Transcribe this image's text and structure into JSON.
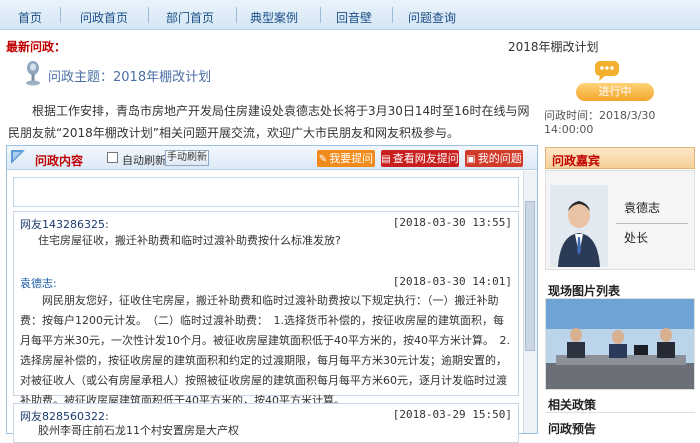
{
  "nav": {
    "items": [
      "首页",
      "问政首页",
      "部门首页",
      "典型案例",
      "回音壁",
      "问题查询"
    ]
  },
  "latest": {
    "label": "最新问政：",
    "right_title": "2018年棚改计划",
    "theme_label": "问政主题：2018年棚改计划",
    "status": "进行中",
    "time_label": "问政时间：",
    "time_value": "2018/3/30 14:00:00",
    "intro": "根据工作安排，青岛市房地产开发局住房建设处袁德志处长将于3月30日14时至16时在线与网民朋友就“2018年棚改计划”相关问题开展交流，欢迎广大市民朋友和网友积极参与。"
  },
  "panel": {
    "title": "问政内容",
    "auto_refresh": "自动刷新",
    "manual_refresh": "手动刷新",
    "btn_ask": "我要提问",
    "btn_view": "查看网友提问",
    "btn_mine": "我的问题"
  },
  "messages": [
    {
      "user": "网友143286325:",
      "time": "[2018-03-30 13:55]",
      "text": "住宅房屋征收，搬迁补助费和临时过渡补助费按什么标准发放?"
    },
    {
      "user": "网友828560322:",
      "time": "[2018-03-29 15:50]",
      "text": "胶州李哥庄前石龙11个村安置房是大产权"
    }
  ],
  "answer": {
    "name": "袁德志:",
    "time": "[2018-03-30 14:01]",
    "text": "网民朋友您好，征收住宅房屋，搬迁补助费和临时过渡补助费按以下规定执行：（一）搬迁补助费：按每户1200元计发。　（二）临时过渡补助费：　1.选择货币补偿的，按征收房屋的建筑面积，每月每平方米30元，一次性计发10个月。被征收房屋建筑面积低于40平方米的，按40平方米计算。　2.选择房屋补偿的，按征收房屋的建筑面积和约定的过渡期限，每月每平方米30元计发；逾期安置的，对被征收人（或公有房屋承租人）按照被征收房屋的建筑面积每月每平方米60元，逐月计发临时过渡补助费。被征收房屋建筑面积低于40平方米的，按40平方米计算。"
  },
  "sidebar": {
    "guest_title": "问政嘉宾",
    "guest_name": "袁德志",
    "guest_role": "处长",
    "photos_title": "现场图片列表",
    "policy_title": "相关政策",
    "preview_title": "问政预告"
  },
  "colors": {
    "accent_red": "#c00000",
    "nav_text": "#1c4f86",
    "btn_orange": "#f08a1a",
    "btn_red": "#c81e1e",
    "btn_darkred": "#d23a2a"
  }
}
